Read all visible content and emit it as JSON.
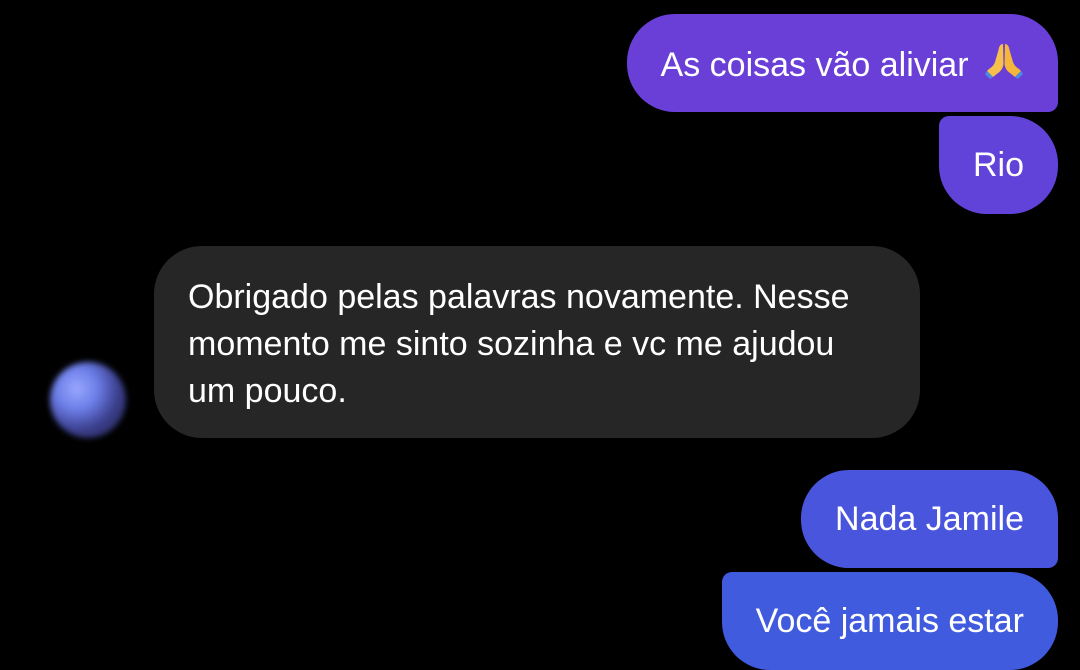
{
  "conversation": {
    "messages": [
      {
        "direction": "outgoing",
        "text": "As coisas vão aliviar",
        "emoji": "folded-hands-icon",
        "color": "#6a3fd7"
      },
      {
        "direction": "outgoing",
        "text": "Rio",
        "color": "#6243d9"
      },
      {
        "direction": "incoming",
        "text": "Obrigado pelas palavras novamente. Nesse momento me sinto sozinha e vc me ajudou um pouco.",
        "color": "#262626"
      },
      {
        "direction": "outgoing",
        "text": "Nada Jamile",
        "color": "#4a55de"
      },
      {
        "direction": "outgoing",
        "text": "Você jamais estar",
        "color": "#415bdf"
      }
    ],
    "contact_avatar": "blurred-avatar"
  },
  "theme": {
    "background": "#000000",
    "text_color": "#ffffff",
    "incoming_bubble": "#262626"
  }
}
